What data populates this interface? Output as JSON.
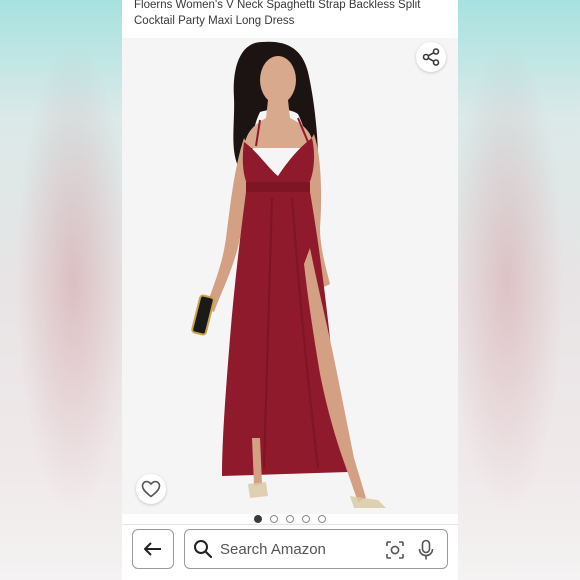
{
  "product": {
    "title": "Floerns Women's V Neck Spaghetti Strap Backless Split Cocktail Party Maxi Long Dress"
  },
  "gallery": {
    "image_count": 5,
    "active_index": 0
  },
  "search": {
    "placeholder": "Search Amazon"
  },
  "icons": {
    "share": "share-icon",
    "heart": "heart-icon",
    "back": "back-arrow-icon",
    "search": "search-icon",
    "lens": "camera-lens-icon",
    "mic": "microphone-icon"
  },
  "colors": {
    "dress": "#8e1a2b",
    "icon": "#3a3a3a"
  }
}
